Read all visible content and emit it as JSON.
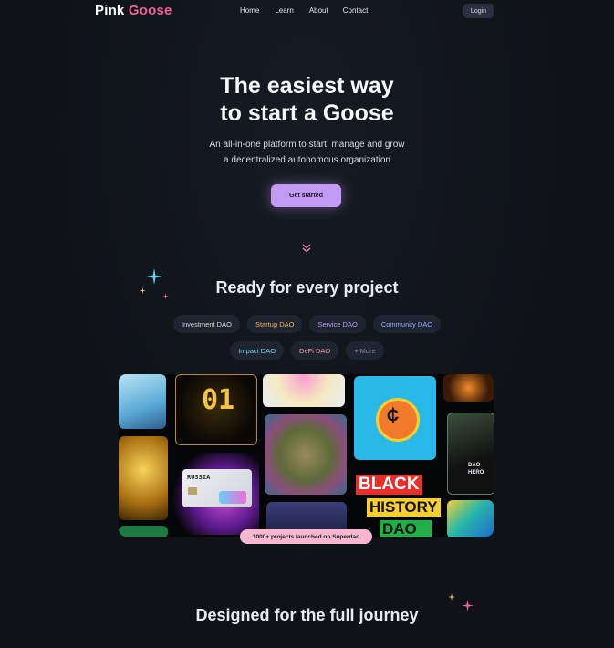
{
  "nav": {
    "logo_primary": "Pink",
    "logo_accent": "Goose",
    "links": [
      "Home",
      "Learn",
      "About",
      "Contact"
    ],
    "login_label": "Login"
  },
  "hero": {
    "title_line1": "The easiest way",
    "title_line2": "to start a Goose",
    "subtitle_line1": "An all-in-one platform to start, manage and grow",
    "subtitle_line2": "a decentralized autonomous organization",
    "cta_label": "Get started"
  },
  "projects": {
    "title": "Ready for every project",
    "tags_row1": [
      {
        "label": "Investment DAO",
        "color": "#d7dbe2"
      },
      {
        "label": "Startup DAO",
        "color": "#f0b35a"
      },
      {
        "label": "Service DAO",
        "color": "#c39bf7"
      },
      {
        "label": "Community DAO",
        "color": "#8fb5ff"
      }
    ],
    "tags_row2": [
      {
        "label": "Impact DAO",
        "color": "#7fd0e8"
      },
      {
        "label": "DeFi DAO",
        "color": "#f29bb8"
      },
      {
        "label": "+ More",
        "color": "#8a909c"
      }
    ],
    "badge": "1000+ projects launched on Superdao",
    "tile_text": {
      "number": "01",
      "card_text": "RUSSIA",
      "black": "BLACK",
      "history": "HISTORY",
      "dao": "DAO",
      "dao_small": "DAO",
      "hero_small": "HERO",
      "coin_symbol": "¢"
    }
  },
  "journey": {
    "title": "Designed for the full journey"
  },
  "colors": {
    "accent_pink": "#f06292",
    "cta_purple": "#c39bf7",
    "badge_pink": "#f6b7cf",
    "background": "#0f1318"
  }
}
